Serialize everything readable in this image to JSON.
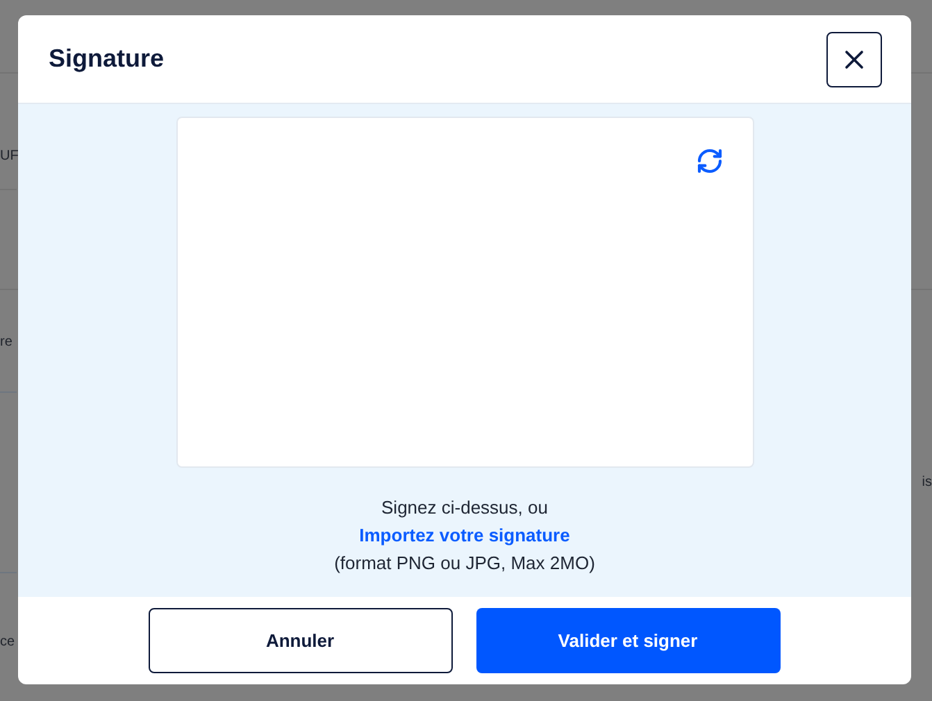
{
  "background": {
    "left_fragments": [
      "UF",
      "re",
      "ce"
    ],
    "right_fragments": [
      "is"
    ]
  },
  "dialog": {
    "title": "Signature",
    "instructions": "Signez ci-dessus, ou",
    "upload_link": "Importez votre signature",
    "format_note": "(format PNG ou JPG, Max 2MO)",
    "buttons": [
      {
        "label": "Annuler",
        "kind": "secondary"
      },
      {
        "label": "Valider et signer",
        "kind": "primary"
      }
    ]
  }
}
